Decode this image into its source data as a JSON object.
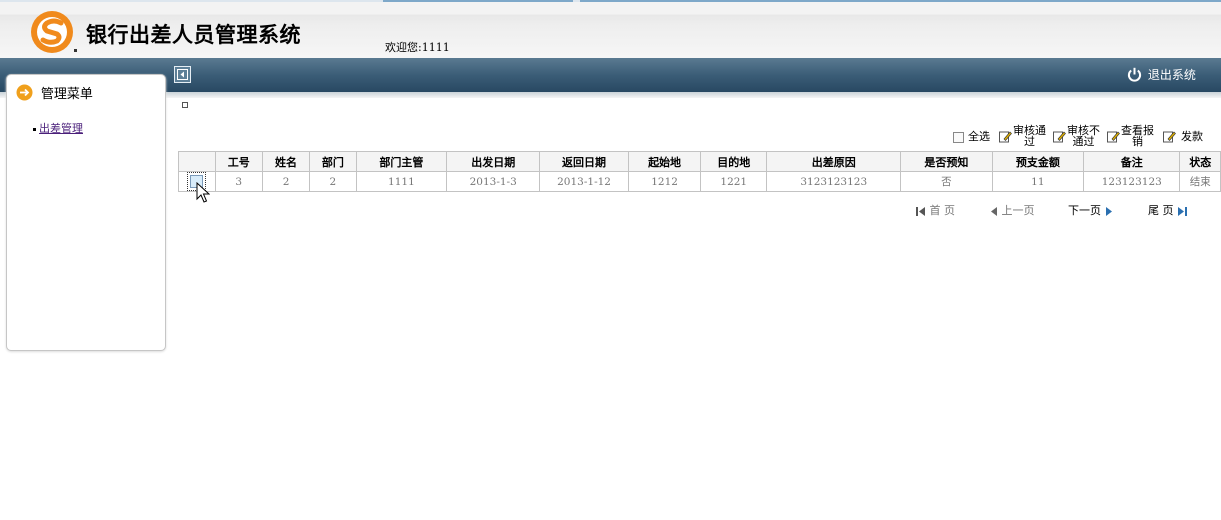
{
  "app": {
    "title": "银行出差人员管理系统",
    "welcome": "欢迎您:1111",
    "logout": "退出系统"
  },
  "sidebar": {
    "header": "管理菜单",
    "items": [
      {
        "label": "出差管理"
      }
    ]
  },
  "toolbar": {
    "select_all": "全选",
    "approve_1": "审核通",
    "approve_2": "过",
    "reject_1": "审核不",
    "reject_2": "通过",
    "view_1": "查看报",
    "view_2": "销",
    "pay": "发款"
  },
  "table": {
    "columns": [
      "",
      "工号",
      "姓名",
      "部门",
      "部门主管",
      "出发日期",
      "返回日期",
      "起始地",
      "目的地",
      "出差原因",
      "是否预知",
      "预支金额",
      "备注",
      "状态"
    ],
    "rows": [
      [
        "3",
        "2",
        "2",
        "1111",
        "2013-1-3",
        "2013-1-12",
        "1212",
        "1221",
        "3123123123",
        "否",
        "11",
        "123123123",
        "结束"
      ]
    ]
  },
  "pager": {
    "first": "首 页",
    "prev": "上一页",
    "next": "下一页",
    "last": "尾 页"
  },
  "colors": {
    "nav_dark": "#284862",
    "nav_light": "#5a7a91",
    "logo_orange": "#f08a1c",
    "link_purple": "#4a1f7a"
  }
}
